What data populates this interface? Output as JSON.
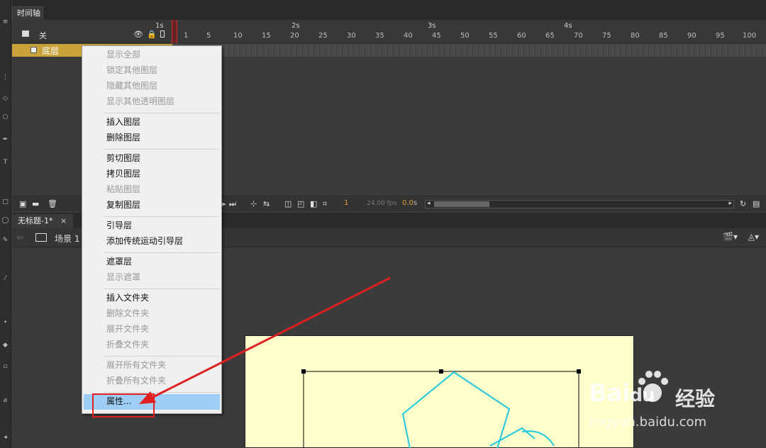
{
  "timeline": {
    "tab_label": "时间轴",
    "header_toggle_label": "关",
    "icons": [
      "eye-icon",
      "lock-icon",
      "outline-icon"
    ],
    "ruler_seconds": [
      "1s",
      "2s",
      "3s",
      "4s"
    ],
    "ruler_frames": [
      "1",
      "5",
      "10",
      "15",
      "20",
      "25",
      "30",
      "35",
      "40",
      "45",
      "50",
      "55",
      "60",
      "65",
      "70",
      "75",
      "80",
      "85",
      "90",
      "95",
      "100"
    ],
    "layer_name": "底层",
    "current_frame": "1",
    "fps": "24.00 fps",
    "elapsed_time": "0.0",
    "time_unit": "s"
  },
  "document": {
    "tab_label": "无标题-1*",
    "close_glyph": "×",
    "scene_label": "场景 1"
  },
  "context_menu": {
    "groups": [
      [
        {
          "label": "显示全部",
          "enabled": false
        },
        {
          "label": "锁定其他图层",
          "enabled": false
        },
        {
          "label": "隐藏其他图层",
          "enabled": false
        },
        {
          "label": "显示其他透明图层",
          "enabled": false
        }
      ],
      [
        {
          "label": "插入图层",
          "enabled": true
        },
        {
          "label": "删除图层",
          "enabled": true
        }
      ],
      [
        {
          "label": "剪切图层",
          "enabled": true
        },
        {
          "label": "拷贝图层",
          "enabled": true
        },
        {
          "label": "粘贴图层",
          "enabled": false
        },
        {
          "label": "复制图层",
          "enabled": true
        }
      ],
      [
        {
          "label": "引导层",
          "enabled": true
        },
        {
          "label": "添加传统运动引导层",
          "enabled": true
        }
      ],
      [
        {
          "label": "遮罩层",
          "enabled": true
        },
        {
          "label": "显示遮罩",
          "enabled": false
        }
      ],
      [
        {
          "label": "插入文件夹",
          "enabled": true
        },
        {
          "label": "删除文件夹",
          "enabled": false
        },
        {
          "label": "展开文件夹",
          "enabled": false
        },
        {
          "label": "折叠文件夹",
          "enabled": false
        }
      ],
      [
        {
          "label": "展开所有文件夹",
          "enabled": false
        },
        {
          "label": "折叠所有文件夹",
          "enabled": false
        }
      ],
      [
        {
          "label": "属性...",
          "enabled": true,
          "highlighted": true
        }
      ]
    ]
  },
  "watermark": {
    "logo": "Bai",
    "logo_suffix": "du",
    "brand": "经验",
    "url": "jingyan.baidu.com"
  },
  "colors": {
    "layer_selected": "#c9a23a",
    "menu_highlight": "#9ecef5",
    "annotation_red": "#e02020",
    "stage_bg": "#ffffcc",
    "shape_stroke": "#22c8e0",
    "playhead": "#d03030"
  }
}
